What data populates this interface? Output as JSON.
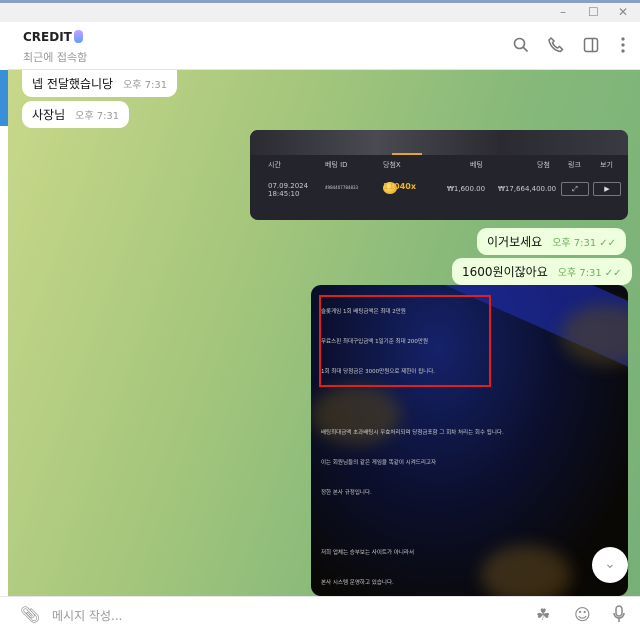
{
  "window": {
    "minimize": "–",
    "maximize": "☐",
    "close": "✕"
  },
  "header": {
    "name": "CREDIT",
    "status": "최근에 접속함",
    "icons": [
      "search-icon",
      "phone-icon",
      "sidebar-toggle-icon",
      "more-vert-icon"
    ]
  },
  "messages": [
    {
      "dir": "in",
      "text": "넵 전달했습니당",
      "time": "오후 7:31"
    },
    {
      "dir": "in",
      "text": "사장님",
      "time": "오후 7:31"
    },
    {
      "dir": "out",
      "text": "이거보세요",
      "time": "오후 7:31",
      "status": "read"
    },
    {
      "dir": "out",
      "text": "1600원이잖아요",
      "time": "오후 7:31",
      "status": "read"
    }
  ],
  "game_table": {
    "headers": [
      "시간",
      "베팅 ID",
      "당첨X",
      "베팅",
      "당첨",
      "링크",
      "보기"
    ],
    "row": {
      "date": "07.09.2024",
      "clock": "18:45:10",
      "bet_id": "4984407784833",
      "multiplier": "11040x",
      "bet": "₩1,600.00",
      "win": "₩17,664,400.00",
      "link": "⤢",
      "view": "▶"
    },
    "accent": "#f0b429"
  },
  "rules_image": {
    "lines": [
      "슬롯게임 1회 배팅금액은 최대 2만원",
      "무료스핀 최대구입금액 1일기준 최대 200만원",
      "1회 최대 당첨금은 3000만원으로 제한이 됩니다.",
      "배팅최대금액 초과배팅시 무효처리되며 당첨금포함 그 회차 처리는 회수 됩니다.",
      "이는 회원님들의 같은 게임을 똑같이 시켜드리고자",
      "정한 본사 규정입니다.",
      "저희 업체는 승부보는 사이트가 아니라서",
      "본사 시스템 운영하고 있습니다."
    ],
    "highlight_color": "#e02020"
  },
  "input": {
    "placeholder": "메시지 작성..."
  },
  "scroll_down": "⌄"
}
